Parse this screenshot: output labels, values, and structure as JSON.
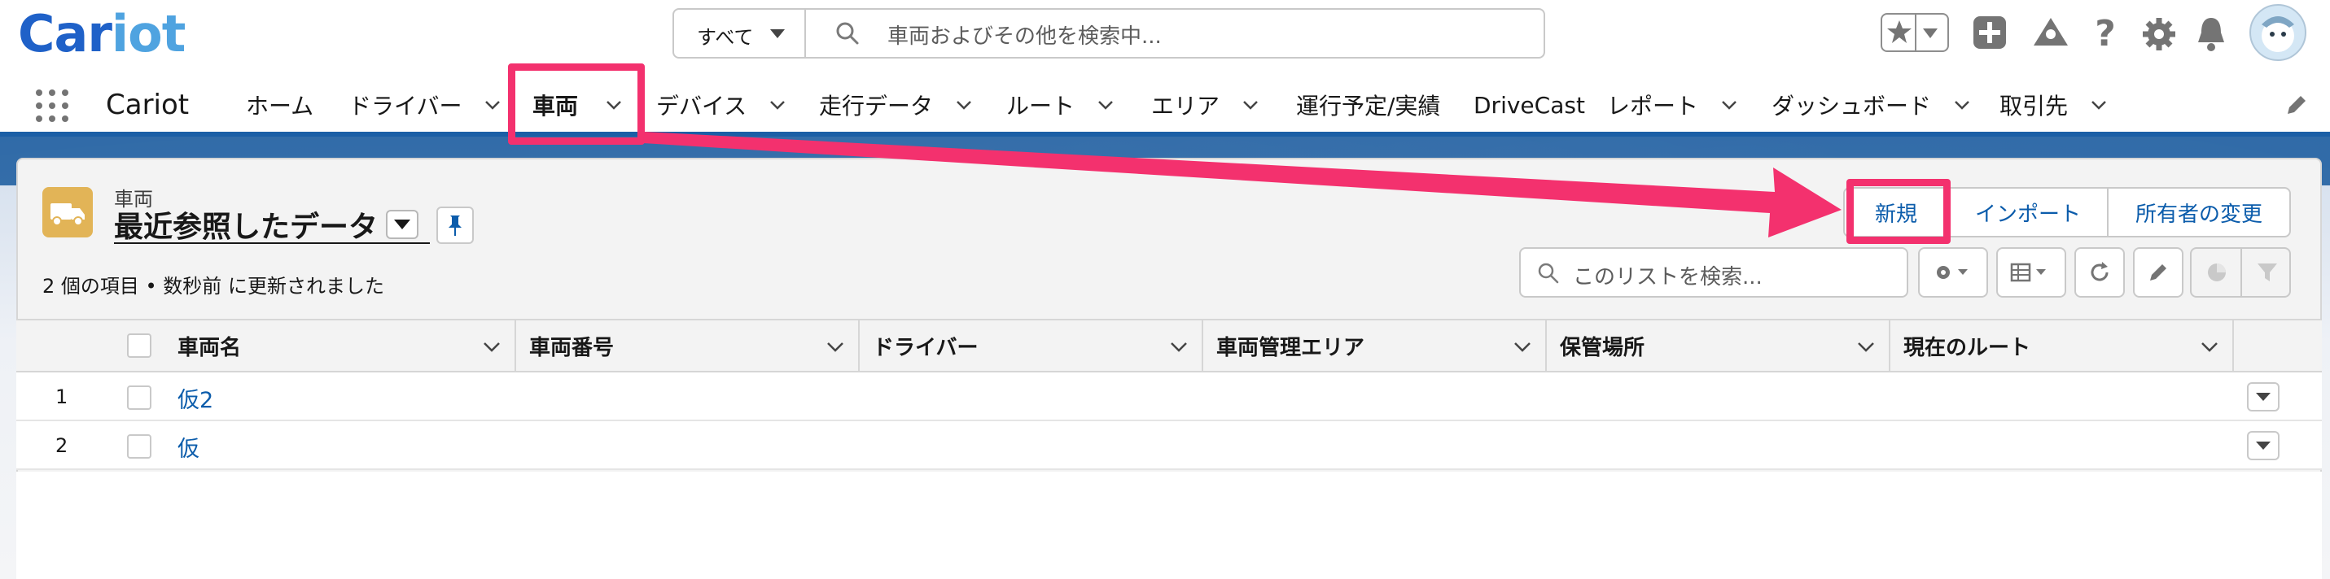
{
  "app": {
    "logo_part1": "Car",
    "logo_part2": "iot",
    "name": "Cariot"
  },
  "search": {
    "scope": "すべて",
    "placeholder": "車両およびその他を検索中..."
  },
  "nav": {
    "items": [
      {
        "label": "ホーム",
        "has_menu": false
      },
      {
        "label": "ドライバー",
        "has_menu": true
      },
      {
        "label": "車両",
        "has_menu": true,
        "active": true
      },
      {
        "label": "デバイス",
        "has_menu": true
      },
      {
        "label": "走行データ",
        "has_menu": true
      },
      {
        "label": "ルート",
        "has_menu": true
      },
      {
        "label": "エリア",
        "has_menu": true
      },
      {
        "label": "運行予定/実績",
        "has_menu": false
      },
      {
        "label": "DriveCast",
        "has_menu": false
      },
      {
        "label": "レポート",
        "has_menu": true
      },
      {
        "label": "ダッシュボード",
        "has_menu": true
      },
      {
        "label": "取引先",
        "has_menu": true
      }
    ]
  },
  "list_view": {
    "object_label": "車両",
    "title": "最近参照したデータ",
    "status": "2 個の項目 • 数秒前 に更新されました",
    "buttons": {
      "new": "新規",
      "import": "インポート",
      "change_owner": "所有者の変更"
    },
    "search_placeholder": "このリストを検索..."
  },
  "table": {
    "columns": [
      "車両名",
      "車両番号",
      "ドライバー",
      "車両管理エリア",
      "保管場所",
      "現在のルート"
    ],
    "rows": [
      {
        "num": "1",
        "name": "仮2"
      },
      {
        "num": "2",
        "name": "仮"
      }
    ]
  },
  "colors": {
    "brand_dark": "#1f61c8",
    "brand_light": "#4fa3e0",
    "link": "#0b5cab",
    "annotation": "#f3316e",
    "nav_border": "#1b5fa6",
    "object_icon": "#e2b457"
  }
}
